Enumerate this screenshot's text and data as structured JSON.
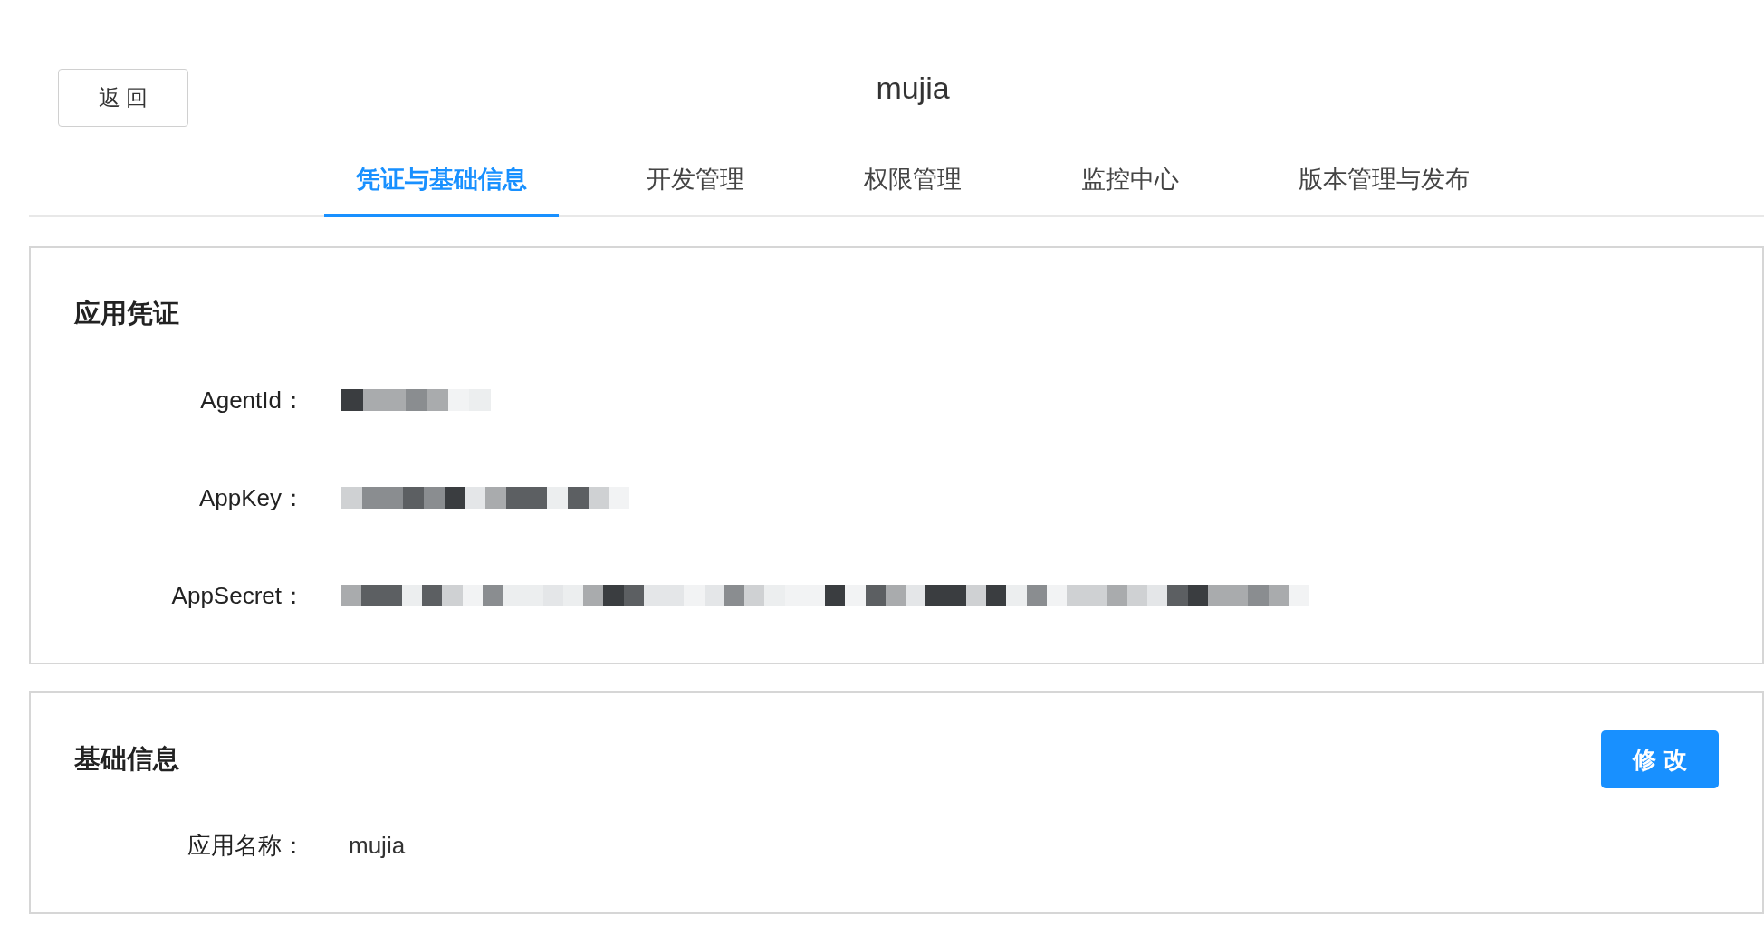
{
  "back_button": {
    "label": "返 回"
  },
  "title": "mujia",
  "tabs": [
    {
      "label": "凭证与基础信息",
      "selected": true
    },
    {
      "label": "开发管理",
      "selected": false
    },
    {
      "label": "权限管理",
      "selected": false
    },
    {
      "label": "监控中心",
      "selected": false
    },
    {
      "label": "版本管理与发布",
      "selected": false
    }
  ],
  "sections": [
    {
      "title": "应用凭证",
      "fields": [
        {
          "label": "AgentId：",
          "kind": "masked"
        },
        {
          "label": "AppKey：",
          "kind": "masked"
        },
        {
          "label": "AppSecret：",
          "kind": "masked"
        }
      ]
    },
    {
      "title": "基础信息",
      "action": "修 改",
      "fields": [
        {
          "label": "应用名称：",
          "kind": "text",
          "value": "mujia"
        }
      ]
    }
  ]
}
